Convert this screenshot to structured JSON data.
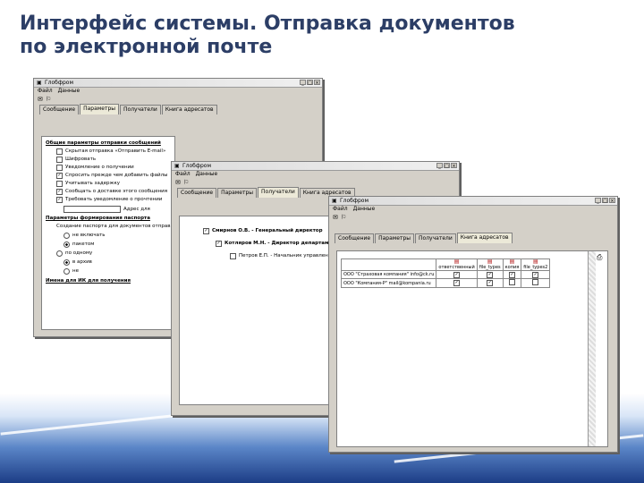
{
  "slide": {
    "title_line1": "Интерфейс системы. Отправка документов",
    "title_line2": "по электронной почте"
  },
  "colors": {
    "title": "#2c3e66",
    "window_bg": "#d4d0c8",
    "band_dark": "#1c3d86"
  },
  "win1": {
    "title": "Глобфром",
    "menu": [
      "Файл",
      "Данные"
    ],
    "toolbar": [
      "✉",
      "⚐"
    ],
    "tabs": [
      "Сообщение",
      "Параметры",
      "Получатели",
      "Книга адресатов"
    ],
    "active_tab": 1,
    "section1": "Общие параметры отправки сообщений",
    "options": [
      {
        "label": "Скрытая отправка «Отправить E-mail»",
        "checked": false
      },
      {
        "label": "Шифровать",
        "checked": false
      },
      {
        "label": "Уведомление о получении",
        "checked": false
      },
      {
        "label": "Спросить прежде чем добавить файлы",
        "checked": true
      },
      {
        "label": "Учитывать задержку",
        "checked": false
      },
      {
        "label": "Сообщать о доставке этого сообщения",
        "checked": true
      },
      {
        "label": "Требовать уведомление о прочтении",
        "checked": true
      }
    ],
    "address_label": "Адрес для",
    "section2": "Параметры формирования паспорта",
    "passport_label": "Создание паспорта для документов отправки",
    "radios": [
      {
        "label": "не включать",
        "checked": false
      },
      {
        "label": "пакетом",
        "checked": true
      },
      {
        "label": "по одному",
        "checked": false
      },
      {
        "label": "в архив",
        "checked": true
      },
      {
        "label": "не",
        "checked": false
      }
    ],
    "section3": "Имена для ИК для получения"
  },
  "win2": {
    "title": "Глобфром",
    "menu": [
      "Файл",
      "Данные"
    ],
    "toolbar": [
      "✉",
      "⚐"
    ],
    "tabs": [
      "Сообщение",
      "Параметры",
      "Получатели",
      "Книга адресатов"
    ],
    "active_tab": 2,
    "recipients": [
      {
        "label": "Смирнов О.В. - Генеральный директор",
        "checked": true,
        "indent": 0
      },
      {
        "label": "Котляров М.Н. - Директор департамента",
        "checked": true,
        "indent": 1
      },
      {
        "label": "Петров Е.П. - Начальник управления",
        "checked": false,
        "indent": 2
      }
    ]
  },
  "win3": {
    "title": "Глобфром",
    "menu": [
      "Файл",
      "Данные"
    ],
    "toolbar": [
      "✉",
      "⚐"
    ],
    "tabs": [
      "Сообщение",
      "Параметры",
      "Получатели",
      "Книга адресатов"
    ],
    "active_tab": 3,
    "columns": [
      "",
      "ответственный",
      "file_types",
      "копия",
      "file_types2"
    ],
    "rows": [
      {
        "name": "ООО \"Страховая компания\" info@ck.ru",
        "checks": [
          true,
          true,
          true,
          true
        ]
      },
      {
        "name": "ООО \"Компания-Р\" mail@kompania.ru",
        "checks": [
          true,
          true,
          false,
          false
        ]
      }
    ]
  }
}
